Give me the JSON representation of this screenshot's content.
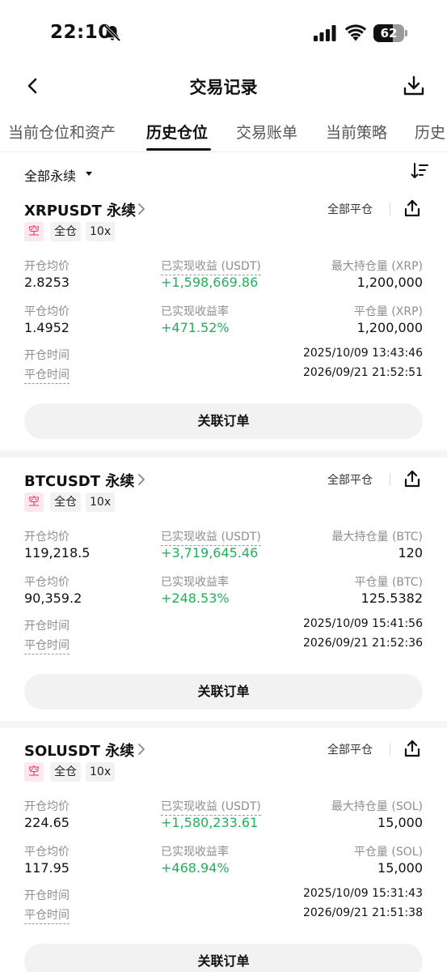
{
  "status_bar": {
    "time": "22:10",
    "battery_level": "62",
    "battery_fraction": 0.62
  },
  "header": {
    "title": "交易记录",
    "back_icon": "chevron-left-icon",
    "download_icon": "download-icon"
  },
  "tabs": [
    {
      "label": "当前仓位和资产",
      "active": false
    },
    {
      "label": "历史仓位",
      "active": true
    },
    {
      "label": "交易账单",
      "active": false
    },
    {
      "label": "当前策略",
      "active": false
    },
    {
      "label": "历史",
      "active": false
    }
  ],
  "filter": {
    "label": "全部永续",
    "sort_icon": "sort-icon"
  },
  "labels": {
    "open_avg": "开仓均价",
    "close_avg": "平仓均价",
    "realized_pnl": "已实现收益 (USDT)",
    "realized_pnl_rate": "已实现收益率",
    "open_time": "开仓时间",
    "close_time": "平仓时间",
    "close_all": "全部平仓",
    "related_orders": "关联订单"
  },
  "colors": {
    "profit_green": "#21b15b",
    "short_tag_text": "#e5336c",
    "short_tag_bg": "#fde8ee"
  },
  "positions": [
    {
      "symbol": "XRPUSDT 永续",
      "side": "空",
      "margin_mode": "全仓",
      "leverage": "10x",
      "open_avg_price": "2.8253",
      "close_avg_price": "1.4952",
      "realized_pnl": "+1,598,669.86",
      "realized_pnl_rate": "+471.52%",
      "max_position_label": "最大持仓量 (XRP)",
      "max_position": "1,200,000",
      "closed_qty_label": "平仓量 (XRP)",
      "closed_qty": "1,200,000",
      "open_time": "2025/10/09 13:43:46",
      "close_time": "2026/09/21 21:52:51"
    },
    {
      "symbol": "BTCUSDT 永续",
      "side": "空",
      "margin_mode": "全仓",
      "leverage": "10x",
      "open_avg_price": "119,218.5",
      "close_avg_price": "90,359.2",
      "realized_pnl": "+3,719,645.46",
      "realized_pnl_rate": "+248.53%",
      "max_position_label": "最大持仓量 (BTC)",
      "max_position": "120",
      "closed_qty_label": "平仓量 (BTC)",
      "closed_qty": "125.5382",
      "open_time": "2025/10/09 15:41:56",
      "close_time": "2026/09/21 21:52:36"
    },
    {
      "symbol": "SOLUSDT 永续",
      "side": "空",
      "margin_mode": "全仓",
      "leverage": "10x",
      "open_avg_price": "224.65",
      "close_avg_price": "117.95",
      "realized_pnl": "+1,580,233.61",
      "realized_pnl_rate": "+468.94%",
      "max_position_label": "最大持仓量 (SOL)",
      "max_position": "15,000",
      "closed_qty_label": "平仓量 (SOL)",
      "closed_qty": "15,000",
      "open_time": "2025/10/09 15:31:43",
      "close_time": "2026/09/21 21:51:38"
    }
  ]
}
